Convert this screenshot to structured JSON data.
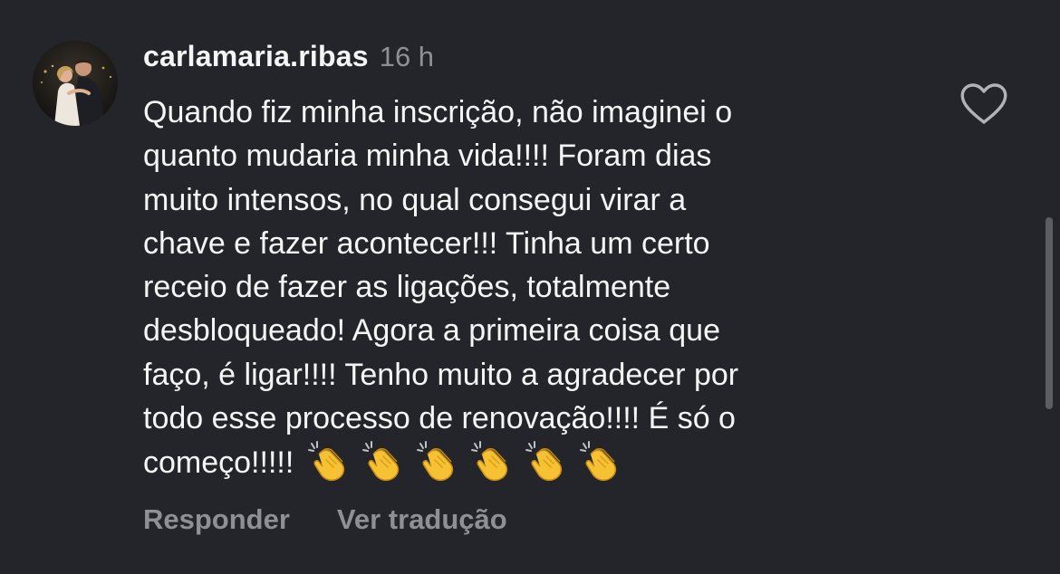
{
  "comment": {
    "username": "carlamaria.ribas",
    "timestamp": "16 h",
    "lines": [
      "Quando fiz minha inscrição, não imaginei o",
      "quanto mudaria minha vida!!!! Foram dias",
      "muito intensos, no qual consegui virar a",
      "chave e fazer acontecer!!! Tinha um certo",
      "receio de fazer as ligações, totalmente",
      "desbloqueado! Agora a primeira coisa que",
      "faço, é ligar!!!! Tenho muito a agradecer por",
      "todo esse processo de renovação!!!! É só o",
      "começo!!!!!"
    ],
    "emojis": [
      "👏",
      "👏",
      "👏",
      "👏",
      "👏",
      "👏"
    ],
    "emoji_icon": "clapping-hands-icon"
  },
  "actions": {
    "reply_label": "Responder",
    "translate_label": "Ver tradução"
  },
  "icons": {
    "like": "heart-outline-icon",
    "avatar": "profile-photo"
  },
  "colors": {
    "background": "#23252a",
    "primary_text": "#f5f5f5",
    "secondary_text": "#8e9096",
    "emoji_yellow": "#f6c234"
  }
}
